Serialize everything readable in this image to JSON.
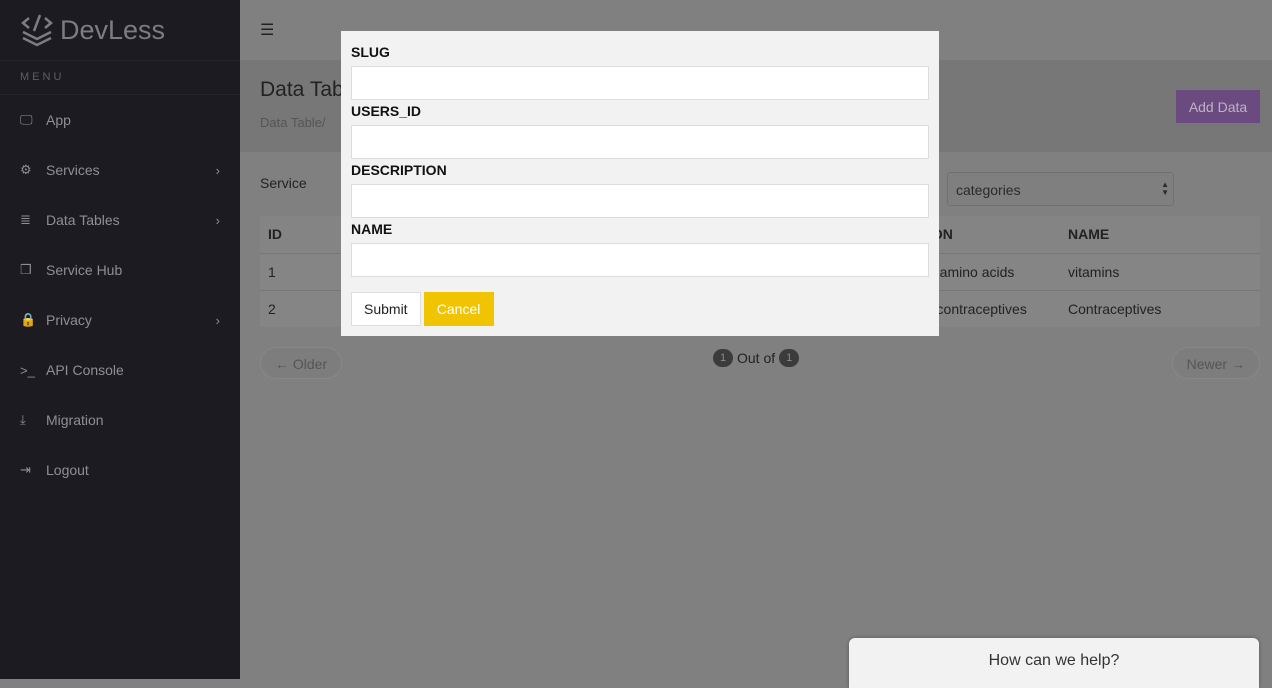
{
  "brand": {
    "name": "DevLess"
  },
  "sidebar": {
    "menu_heading": "MENU",
    "items": [
      {
        "label": "App",
        "icon": "monitor-icon",
        "chevron": false
      },
      {
        "label": "Services",
        "icon": "cogs-icon",
        "chevron": true
      },
      {
        "label": "Data Tables",
        "icon": "database-icon",
        "chevron": true
      },
      {
        "label": "Service Hub",
        "icon": "cubes-icon",
        "chevron": false
      },
      {
        "label": "Privacy",
        "icon": "lock-icon",
        "chevron": true
      },
      {
        "label": "API Console",
        "icon": "terminal-icon",
        "chevron": false
      },
      {
        "label": "Migration",
        "icon": "download-icon",
        "chevron": false
      },
      {
        "label": "Logout",
        "icon": "sign-out-icon",
        "chevron": false
      }
    ]
  },
  "header": {
    "title": "Data Table",
    "breadcrumb": "Data Table/",
    "add_label": "Add Data"
  },
  "filter": {
    "service_label": "Service",
    "table_select": "categories"
  },
  "table": {
    "headers": [
      "ID",
      "ION",
      "NAME"
    ],
    "rows": [
      [
        "1",
        "d amino acids",
        "vitamins"
      ],
      [
        "2",
        "r contraceptives",
        "Contraceptives"
      ]
    ]
  },
  "pagination": {
    "older": "← Older",
    "newer": "Newer →",
    "current": "1",
    "out_of": "Out of",
    "total": "1"
  },
  "modal": {
    "fields": [
      {
        "label": "SLUG",
        "value": ""
      },
      {
        "label": "USERS_ID",
        "value": ""
      },
      {
        "label": "DESCRIPTION",
        "value": ""
      },
      {
        "label": "NAME",
        "value": ""
      }
    ],
    "submit": "Submit",
    "cancel": "Cancel"
  },
  "help": {
    "label": "How can we help?"
  },
  "colors": {
    "accent": "#6b4a80",
    "cancel": "#f0c400",
    "sidebar": "#1c1b21"
  }
}
